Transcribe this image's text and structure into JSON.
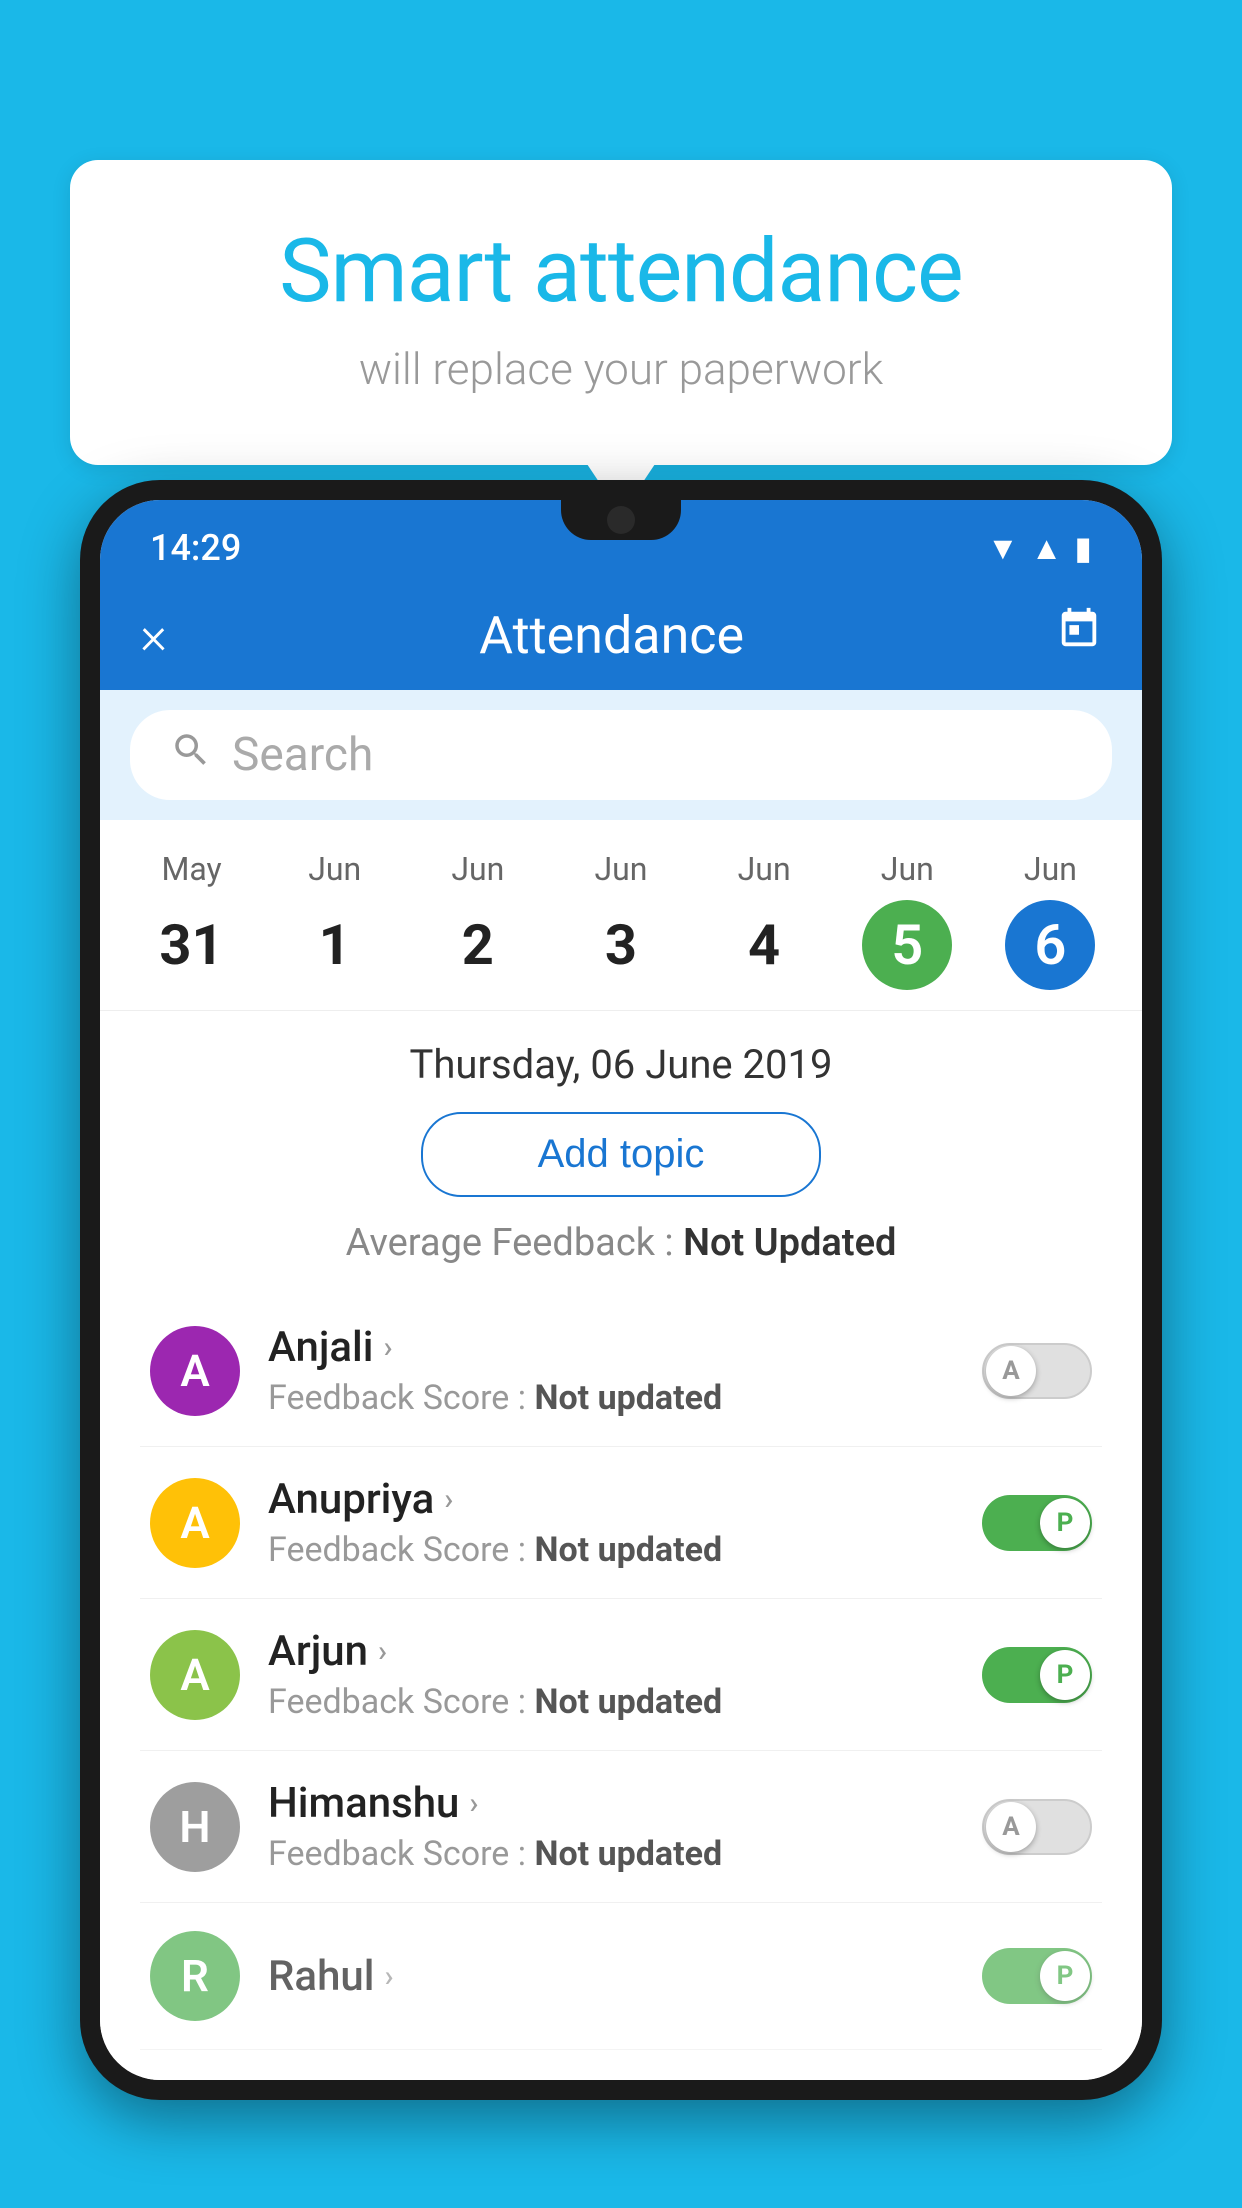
{
  "background": {
    "color": "#1ab8e8"
  },
  "speech_bubble": {
    "title": "Smart attendance",
    "subtitle": "will replace your paperwork"
  },
  "phone": {
    "status_bar": {
      "time": "14:29"
    },
    "app_bar": {
      "title": "Attendance",
      "close_label": "×",
      "calendar_icon": "📅"
    },
    "search": {
      "placeholder": "Search"
    },
    "calendar": {
      "days": [
        {
          "month": "May",
          "date": "31",
          "state": "normal"
        },
        {
          "month": "Jun",
          "date": "1",
          "state": "normal"
        },
        {
          "month": "Jun",
          "date": "2",
          "state": "normal"
        },
        {
          "month": "Jun",
          "date": "3",
          "state": "normal"
        },
        {
          "month": "Jun",
          "date": "4",
          "state": "normal"
        },
        {
          "month": "Jun",
          "date": "5",
          "state": "today"
        },
        {
          "month": "Jun",
          "date": "6",
          "state": "selected"
        }
      ]
    },
    "date_header": "Thursday, 06 June 2019",
    "add_topic_label": "Add topic",
    "avg_feedback_label": "Average Feedback : ",
    "avg_feedback_value": "Not Updated",
    "students": [
      {
        "name": "Anjali",
        "avatar_letter": "A",
        "avatar_color": "#9c27b0",
        "feedback_label": "Feedback Score : ",
        "feedback_value": "Not updated",
        "toggle_state": "off",
        "toggle_letter": "A"
      },
      {
        "name": "Anupriya",
        "avatar_letter": "A",
        "avatar_color": "#ffc107",
        "feedback_label": "Feedback Score : ",
        "feedback_value": "Not updated",
        "toggle_state": "on",
        "toggle_letter": "P"
      },
      {
        "name": "Arjun",
        "avatar_letter": "A",
        "avatar_color": "#8bc34a",
        "feedback_label": "Feedback Score : ",
        "feedback_value": "Not updated",
        "toggle_state": "on",
        "toggle_letter": "P"
      },
      {
        "name": "Himanshu",
        "avatar_letter": "H",
        "avatar_color": "#9e9e9e",
        "feedback_label": "Feedback Score : ",
        "feedback_value": "Not updated",
        "toggle_state": "off",
        "toggle_letter": "A"
      }
    ]
  }
}
